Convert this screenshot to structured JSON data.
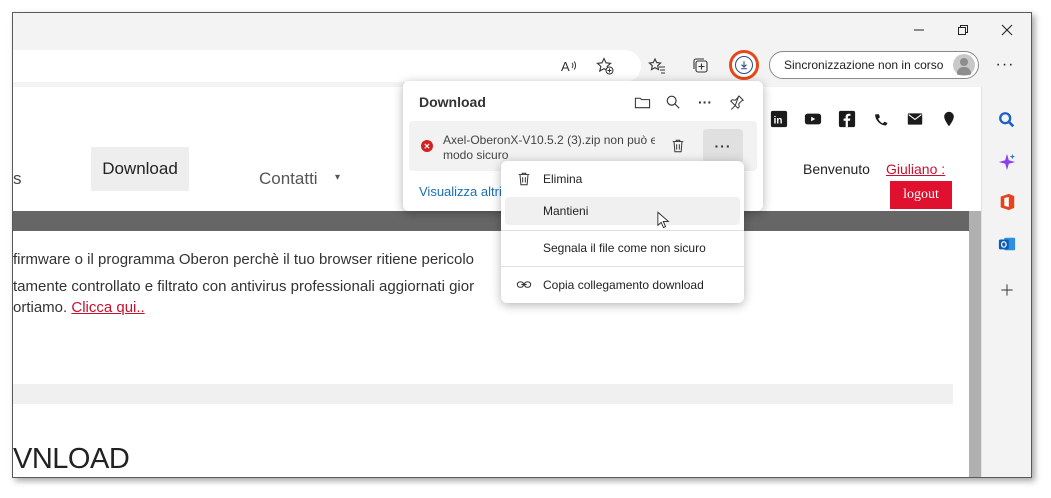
{
  "window": {
    "controls": [
      "minimize",
      "restore",
      "close"
    ]
  },
  "toolbar": {
    "sync_label": "Sincronizzazione non in corso",
    "icons": [
      "read-aloud-icon",
      "add-favorite-icon",
      "favorites-icon",
      "collections-icon",
      "downloads-icon",
      "more-icon"
    ]
  },
  "site": {
    "nav": {
      "partial_item": "s",
      "download": "Download",
      "contatti": "Contatti",
      "caret": "▾"
    },
    "welcome": "Benvenuto",
    "user": "Giuliano :",
    "logout": "logout",
    "para_line1": "firmware o il programma Oberon perchè il tuo browser ritiene pericolo",
    "para_line2": "tamente controllato e filtrato con antivirus professionali aggiornati gior",
    "para_line3_prefix": "ortiamo. ",
    "para_link": "Clicca qui..",
    "big_title": "VNLOAD"
  },
  "download_panel": {
    "title": "Download",
    "file_line1": "Axel-OberonX-V10.5.2 (3).zip non può e",
    "file_line2": "modo sicuro",
    "more_label": "···",
    "footer_link": "Visualizza altri"
  },
  "context_menu": {
    "items": [
      {
        "label": "Elimina",
        "icon": "trash-icon"
      },
      {
        "label": "Mantieni",
        "icon": "none"
      },
      {
        "label": "Segnala il file come non sicuro",
        "icon": "none"
      },
      {
        "label": "Copia collegamento download",
        "icon": "link-icon"
      }
    ]
  },
  "colors": {
    "accent_red": "#e0102f",
    "download_ring": "#e8471a",
    "link_blue": "#1a6fb5"
  }
}
